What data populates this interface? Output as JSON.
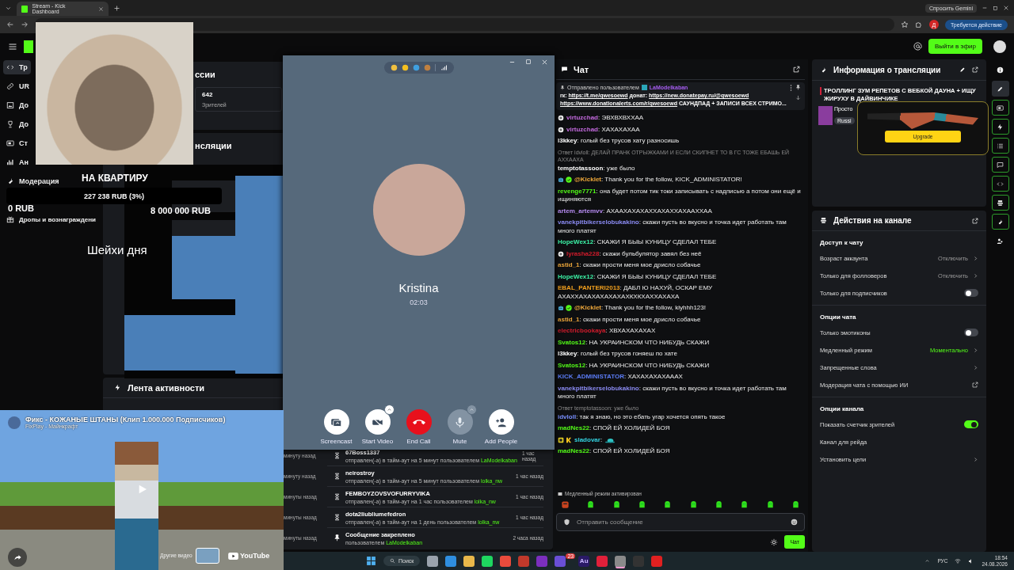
{
  "browser": {
    "tab_title": "Stream - Kick Dashboard",
    "gemini": "Спросить Gemini",
    "profile": "Д",
    "action": "Требуется действие"
  },
  "header": {
    "go_live": "Выйти в эфир"
  },
  "sidebar": {
    "items": [
      {
        "label": "Тр",
        "selected": true
      },
      {
        "label": "UR",
        "selected": false
      },
      {
        "label": "До",
        "selected": false
      },
      {
        "label": "До",
        "selected": false
      },
      {
        "label": "Ст",
        "selected": false
      },
      {
        "label": "Ан",
        "selected": false
      },
      {
        "label": "Модерация",
        "selected": false
      },
      {
        "label": "Дропы и вознаграждени",
        "selected": false
      }
    ]
  },
  "stream_overlay": {
    "goal": "НА КВАРТИРУ",
    "progress": "227 238 RUB (3%)",
    "min": "0 RUB",
    "max": "8 000 000 RUB",
    "caption": "Шейхи дня"
  },
  "center": {
    "sessions_heading": "ссии",
    "viewers": "642",
    "viewers_label": "Зрителей",
    "info_heading": "нсляции",
    "activity_heading": "Лента активности",
    "background_times": [
      "минуту назад",
      "минуту назад",
      "минуты назад",
      "минуты назад",
      "минуты назад"
    ],
    "activity": [
      {
        "kind": "timeout",
        "user": "67Boss1337",
        "action": "отправлен(-а) в тайм-аут на 5 минут пользователем",
        "by": "LaModelkaban",
        "time": "1 час назад"
      },
      {
        "kind": "timeout",
        "user": "neirostroy",
        "action": "отправлен(-а) в тайм-аут на 5 минут пользователем",
        "by": "lolka_nw",
        "time": "1 час назад"
      },
      {
        "kind": "timeout",
        "user": "FEMBOYZOVSVOFURRYVIKA",
        "action": "отправлен(-а) в тайм-аут на 1 час пользователем",
        "by": "lolka_nw",
        "time": "1 час назад"
      },
      {
        "kind": "timeout",
        "user": "dota2liubliumefedron",
        "action": "отправлен(-а) в тайм-аут на 1 день пользователем",
        "by": "lolka_nw",
        "time": "1 час назад"
      },
      {
        "kind": "pin",
        "user": "Сообщение закреплено",
        "action": "пользователем",
        "by": "LaModelkaban",
        "time": "2 часа назад"
      }
    ]
  },
  "call": {
    "name": "Kristina",
    "duration": "02:03",
    "buttons": [
      {
        "kind": "screencast",
        "label": "Screencast",
        "has_menu": false,
        "disabled": false
      },
      {
        "kind": "video",
        "label": "Start Video",
        "has_menu": true,
        "disabled": false
      },
      {
        "kind": "end",
        "label": "End Call",
        "has_menu": false,
        "disabled": false
      },
      {
        "kind": "mute",
        "label": "Mute",
        "has_menu": true,
        "disabled": true
      },
      {
        "kind": "add",
        "label": "Add People",
        "has_menu": false,
        "disabled": false
      }
    ]
  },
  "video": {
    "title": "Фикс - КОЖАНЫЕ ШТАНЫ (Клип 1.000.000 Подписчиков)",
    "channel": "FixPlay - Майнкрафт",
    "more": "Другие видео",
    "brand": "YouTube"
  },
  "chat": {
    "title": "Чат",
    "pinned": {
      "header": "Отправлено пользователем",
      "user": "LaModelkaban",
      "lines": [
        [
          {
            "kind": "text",
            "text": "rк: "
          },
          {
            "kind": "link",
            "text": "https://t.me/qwesoewd"
          },
          {
            "kind": "text",
            "text": " донат: "
          },
          {
            "kind": "link",
            "text": "https://new.donatepay.ru/@qwesoewd"
          }
        ],
        [
          {
            "kind": "link",
            "text": "https://www.donationalerts.com/r/qwesoewd"
          },
          {
            "kind": "text",
            "text": " САУНДПАД + ЗАПИСИ ВСЕХ СТРИМО..."
          }
        ]
      ]
    },
    "messages": [
      {
        "user": "virtuzchad",
        "color": "#c46adf",
        "text": ": ЭВХВХВХХАА",
        "badges": [
          {
            "kind": "ring"
          }
        ]
      },
      {
        "user": "virtuzchad",
        "color": "#c46adf",
        "text": ": ХАХАХАХАА",
        "badges": [
          {
            "kind": "ring"
          }
        ]
      },
      {
        "user": "l3kkey",
        "color": "#ffffff",
        "text": ": голый без трусов хату разносишь"
      },
      {
        "user": "temptotassoon",
        "color": "#ffffff",
        "text": ": уже было",
        "reply": "Ответ idvloll: ДЕЛАЙ ПРАНК ОТРЫЖКАМИ И ЕСЛИ СКИПНЕТ ТО В ГС ТОЖЕ ЕБАШЬ ЕЙ АХХААХА"
      },
      {
        "user": "@Kicklet",
        "color": "#f0a93b",
        "text": ": Thank you for the follow, KICK_ADMINISTATOR!",
        "badges": [
          {
            "kind": "bot"
          },
          {
            "kind": "verified"
          }
        ]
      },
      {
        "user": "revenge7771",
        "color": "#53fc18",
        "text": ": она будет потом тик токи записывать с надписью а потом они ещё и ищиняются"
      },
      {
        "user": "artem_artemvv",
        "color": "#b78cf2",
        "text": ": АХААХАХАХАХХАХАХХАХААХХАА"
      },
      {
        "user": "vanekpitbikerselobukakino",
        "color": "#8c8cf5",
        "text": ": скажи пусть во вкусно и точка идет работать там много платят"
      },
      {
        "user": "HopeWex12",
        "color": "#3cf2a6",
        "text": ": СКАЖИ Я БЫЫ КУНИЦУ СДЕЛАЛ ТЕБЕ"
      },
      {
        "user": "lyrasha228",
        "color": "#d41c2c",
        "text": ": скажи бульбулятор завял без неё",
        "badges": [
          {
            "kind": "ring"
          }
        ]
      },
      {
        "user": "astid_1",
        "color": "#e9a43a",
        "text": ": скажи прости меня мое дрисло собачье"
      },
      {
        "user": "HopeWex12",
        "color": "#3cf2a6",
        "text": ": СКАЖИ Я БЫЫ КУНИЦУ СДЕЛАЛ ТЕБЕ"
      },
      {
        "user": "EBAL_PANTERI2013",
        "color": "#f2a01e",
        "text": ": ДАБЛ Ю НАХУЙ, ОСКАР ЕМУ АХАХХАХАХАХАХАХАХКХКХАХХАХАХА"
      },
      {
        "user": "@Kicklet",
        "color": "#f0a93b",
        "text": ": Thank you for the follow, kiyhhh123!",
        "badges": [
          {
            "kind": "bot"
          },
          {
            "kind": "verified"
          }
        ]
      },
      {
        "user": "astid_1",
        "color": "#e9a43a",
        "text": ": скажи прости меня мое дрисло собачье"
      },
      {
        "user": "electricbookaya",
        "color": "#d41c2c",
        "text": ": ХВХАХАХАХАХ"
      },
      {
        "user": "Svatos12",
        "color": "#53fc18",
        "text": ": НА УКРАИНСКОМ ЧТО НИБУДЬ СКАЖИ"
      },
      {
        "user": "l3kkey",
        "color": "#ffffff",
        "text": ": голый без трусов гоняеш по хате"
      },
      {
        "user": "Svatos12",
        "color": "#53fc18",
        "text": ": НА УКРАИНСКОМ ЧТО НИБУДЬ СКАЖИ"
      },
      {
        "user": "KICK_ADMINISTATOR",
        "color": "#5b7cf5",
        "text": ": ХАХАХАХАХАААХ"
      },
      {
        "user": "vanekpitbikerselobukakino",
        "color": "#8c8cf5",
        "text": ": скажи пусть во вкусно и точка идет работать там много платят"
      },
      {
        "user": "idvloll",
        "color": "#7a90ff",
        "text": ": так я знаю, но это ебать угар хочется опять такое",
        "reply": "Ответ temptotassoon: уже было"
      },
      {
        "user": "madNes22",
        "color": "#53fc18",
        "text": ": СПОЙ ЕЙ ХОЛИДЕЙ БОЯ"
      },
      {
        "user": "sladovar",
        "color": "#34d3e0",
        "text": ":",
        "badges": [
          {
            "kind": "sub"
          },
          {
            "kind": "kick"
          }
        ],
        "emote": true
      },
      {
        "user": "madNes22",
        "color": "#53fc18",
        "text": ": СПОЙ ЕЙ ХОЛИДЕЙ БОЯ"
      }
    ],
    "notice": "Медленный режим активирован",
    "placeholder": "Отправить сообщение",
    "send": "Чат"
  },
  "info": {
    "title": "Информация о трансляции",
    "stream_title": "ТРОЛЛИНГ ЗУМ РЕПЕТОВ С ВЕБКОЙ ДАУНА + ИЩУ ЖИРУХУ В ДАЙВИНЧИКЕ",
    "category": "Просто",
    "tag": "Russi",
    "upgrade": "Upgrade"
  },
  "actions": {
    "title": "Действия на канале",
    "sections": [
      {
        "title": "Доступ к чату",
        "rows": [
          {
            "kind": "value",
            "label": "Возраст аккаунта",
            "value": "Отключить",
            "active": false
          },
          {
            "kind": "value",
            "label": "Только для фолловеров",
            "value": "Отключить",
            "active": false
          },
          {
            "kind": "toggle",
            "label": "Только для подписчиков",
            "on": false
          }
        ]
      },
      {
        "title": "Опции чата",
        "rows": [
          {
            "kind": "toggle",
            "label": "Только эмотиконы",
            "on": false
          },
          {
            "kind": "value",
            "label": "Медленный режим",
            "value": "Моментально",
            "active": true
          },
          {
            "kind": "link",
            "label": "Запрещенные слова"
          },
          {
            "kind": "external",
            "label": "Модерация чата с помощью ИИ"
          }
        ]
      },
      {
        "title": "Опции канала",
        "rows": [
          {
            "kind": "toggle",
            "label": "Показать счетчик зрителей",
            "on": true
          },
          {
            "kind": "plain",
            "label": "Канал для рейда"
          },
          {
            "kind": "link",
            "label": "Установить цели"
          }
        ]
      }
    ]
  },
  "rail": [
    {
      "kind": "plain"
    },
    {
      "kind": "current"
    },
    {
      "kind": "outlined"
    },
    {
      "kind": "outlined"
    },
    {
      "kind": "outlined"
    },
    {
      "kind": "outlined"
    },
    {
      "kind": "outlined"
    },
    {
      "kind": "outlined"
    },
    {
      "kind": "outlined"
    },
    {
      "kind": "plain"
    }
  ],
  "taskbar": {
    "search": "Поиск",
    "apps": [
      {
        "color": "#9aa3ad",
        "selected": false
      },
      {
        "color": "#2f8fe0",
        "selected": false
      },
      {
        "color": "#e8b84a",
        "selected": false
      },
      {
        "color": "#1ed760",
        "selected": false
      },
      {
        "color": "#e94b3c",
        "selected": false
      },
      {
        "color": "#c0392b",
        "selected": false
      },
      {
        "color": "#7b2fbe",
        "selected": false
      },
      {
        "color": "#6a4fd6",
        "selected": false,
        "badge": "23"
      },
      {
        "color": "#2a1a66",
        "selected": false,
        "label": "Au"
      },
      {
        "color": "#e0203a",
        "selected": false
      },
      {
        "color": "#8a8a8a",
        "selected": true
      },
      {
        "color": "#333333",
        "selected": false
      },
      {
        "color": "#e02020",
        "selected": false
      }
    ],
    "lang": "РУС",
    "time": "18:54",
    "date": "24.08.2026"
  }
}
